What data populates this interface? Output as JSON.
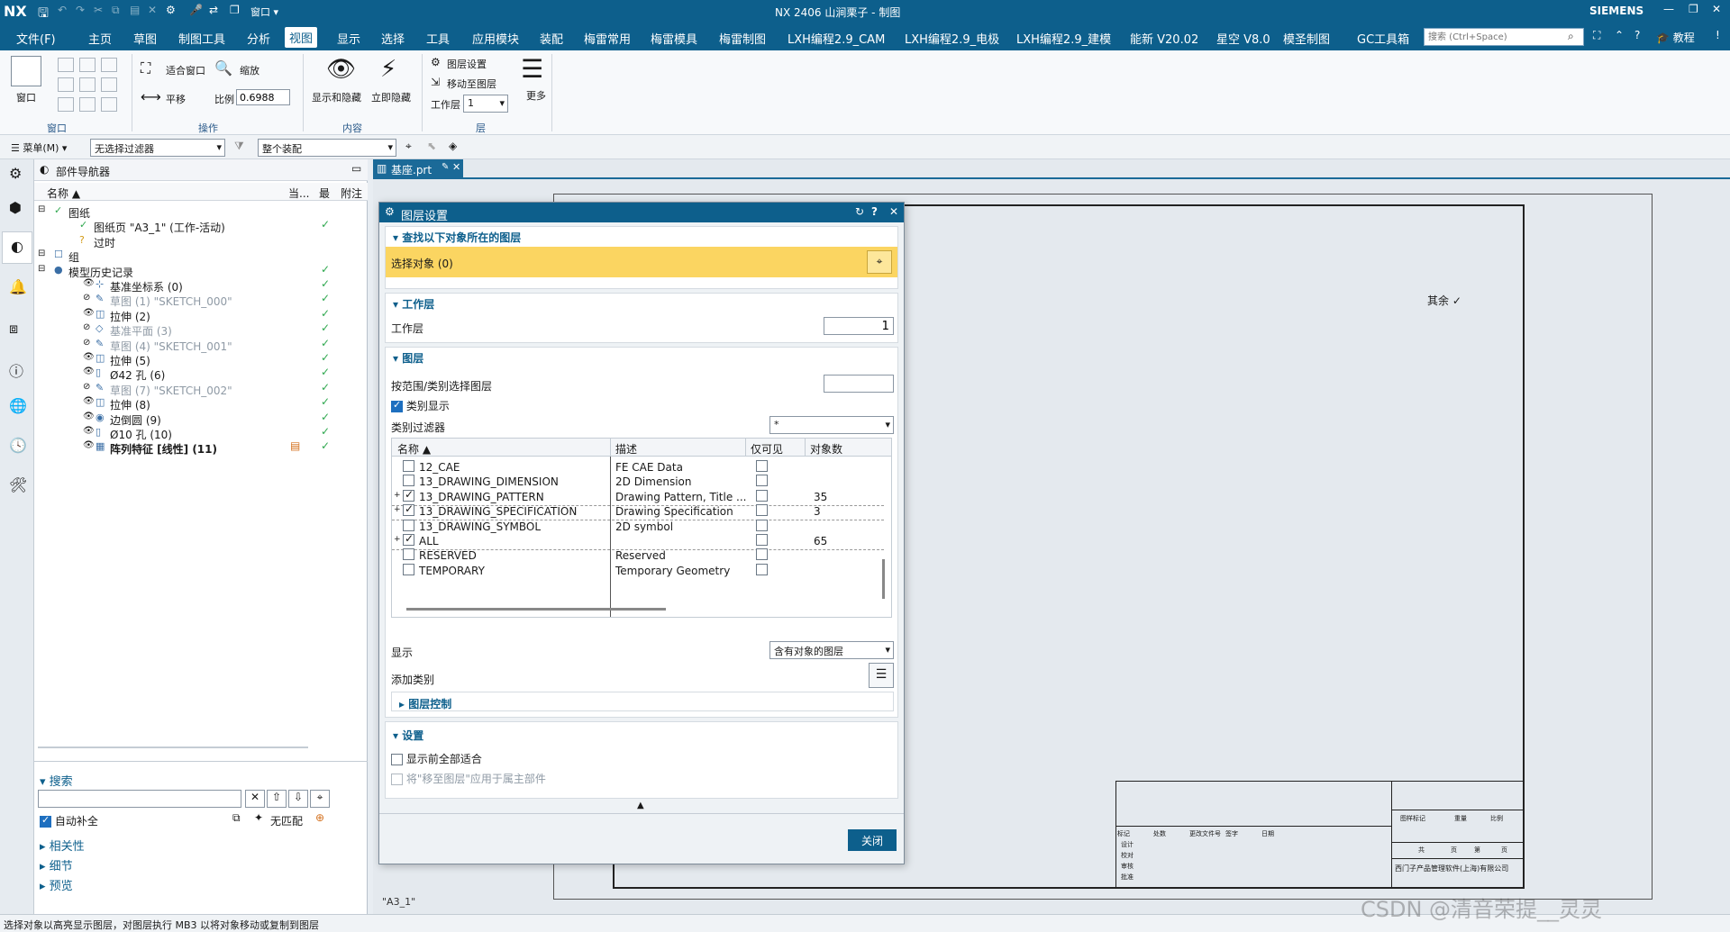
{
  "titlebar": {
    "logo": "NX",
    "title": "NX 2406 山涧栗子 - 制图",
    "brand": "SIEMENS",
    "window_menu": "窗口"
  },
  "menubar": {
    "items": [
      "文件(F)",
      "主页",
      "草图",
      "制图工具",
      "分析",
      "视图",
      "显示",
      "选择",
      "工具",
      "应用模块",
      "装配",
      "梅雷常用",
      "梅雷模具",
      "梅雷制图",
      "LXH编程2.9_CAM",
      "LXH编程2.9_电极",
      "LXH编程2.9_建模",
      "能新 V20.02",
      "星空 V8.0",
      "模圣制图",
      "GC工具箱"
    ],
    "active": "视图",
    "search_placeholder": "搜索 (Ctrl+Space)",
    "tutorial": "教程"
  },
  "ribbon": {
    "window_group": "窗口",
    "window_btn": "窗口",
    "ops_group": "操作",
    "fit_window": "适合窗口",
    "zoom": "缩放",
    "pan": "平移",
    "scale_label": "比例",
    "scale_value": "0.6988",
    "content_group": "内容",
    "show_hide": "显示和隐藏",
    "hide_now": "立即隐藏",
    "layer_group": "层",
    "layer_settings": "图层设置",
    "move_to_layer": "移动至图层",
    "work_layer_label": "工作层",
    "work_layer_value": "1",
    "more": "更多"
  },
  "cmdbar": {
    "menu": "菜单(M)",
    "filter": "无选择过滤器",
    "assembly": "整个装配"
  },
  "navigator": {
    "title": "部件导航器",
    "col_name": "名称",
    "col_current": "当...",
    "col_latest": "最",
    "col_note": "附注",
    "rows": [
      {
        "label": "图纸",
        "indent": 0,
        "grey": false,
        "bold": false
      },
      {
        "label": "图纸页 \"A3_1\" (工作-活动)",
        "indent": 2,
        "grey": false,
        "bold": false
      },
      {
        "label": "过时",
        "indent": 2,
        "grey": false,
        "bold": false
      },
      {
        "label": "组",
        "indent": 0,
        "grey": false,
        "bold": false
      },
      {
        "label": "模型历史记录",
        "indent": 0,
        "grey": false,
        "bold": false
      },
      {
        "label": "基准坐标系 (0)",
        "indent": 2,
        "grey": false,
        "bold": false
      },
      {
        "label": "草图 (1) \"SKETCH_000\"",
        "indent": 2,
        "grey": true,
        "bold": false
      },
      {
        "label": "拉伸 (2)",
        "indent": 2,
        "grey": false,
        "bold": false
      },
      {
        "label": "基准平面 (3)",
        "indent": 2,
        "grey": true,
        "bold": false
      },
      {
        "label": "草图 (4) \"SKETCH_001\"",
        "indent": 2,
        "grey": true,
        "bold": false
      },
      {
        "label": "拉伸 (5)",
        "indent": 2,
        "grey": false,
        "bold": false
      },
      {
        "label": "Ø42 孔 (6)",
        "indent": 2,
        "grey": false,
        "bold": false
      },
      {
        "label": "草图 (7) \"SKETCH_002\"",
        "indent": 2,
        "grey": true,
        "bold": false
      },
      {
        "label": "拉伸 (8)",
        "indent": 2,
        "grey": false,
        "bold": false
      },
      {
        "label": "边倒圆 (9)",
        "indent": 2,
        "grey": false,
        "bold": false
      },
      {
        "label": "Ø10 孔 (10)",
        "indent": 2,
        "grey": false,
        "bold": false
      },
      {
        "label": "阵列特征 [线性] (11)",
        "indent": 2,
        "grey": false,
        "bold": true
      }
    ],
    "search_label": "搜索",
    "auto_complete": "自动补全",
    "no_match": "无匹配",
    "relevance": "相关性",
    "details": "细节",
    "preview": "预览"
  },
  "tab": {
    "name": "基座.prt"
  },
  "dialog": {
    "title": "图层设置",
    "sec_find": "查找以下对象所在的图层",
    "select_object": "选择对象 (0)",
    "sec_work": "工作层",
    "work_layer_label": "工作层",
    "work_layer_value": "1",
    "sec_layers": "图层",
    "range_label": "按范围/类别选择图层",
    "category_display": "类别显示",
    "category_filter_label": "类别过滤器",
    "category_filter_value": "*",
    "col_name": "名称",
    "col_desc": "描述",
    "col_visible": "仅可见",
    "col_count": "对象数",
    "rows": [
      {
        "name": "12_CAE",
        "desc": "FE CAE Data",
        "checked": false,
        "count": "",
        "expand": false
      },
      {
        "name": "13_DRAWING_DIMENSION",
        "desc": "2D Dimension",
        "checked": false,
        "count": "",
        "expand": false
      },
      {
        "name": "13_DRAWING_PATTERN",
        "desc": "Drawing Pattern, Title ...",
        "checked": true,
        "count": "35",
        "expand": true
      },
      {
        "name": "13_DRAWING_SPECIFICATION",
        "desc": "Drawing Specification",
        "checked": true,
        "count": "3",
        "expand": true
      },
      {
        "name": "13_DRAWING_SYMBOL",
        "desc": "2D symbol",
        "checked": false,
        "count": "",
        "expand": false
      },
      {
        "name": "ALL",
        "desc": "",
        "checked": true,
        "count": "65",
        "expand": true
      },
      {
        "name": "RESERVED",
        "desc": "Reserved",
        "checked": false,
        "count": "",
        "expand": false
      },
      {
        "name": "TEMPORARY",
        "desc": "Temporary Geometry",
        "checked": false,
        "count": "",
        "expand": false
      }
    ],
    "display_label": "显示",
    "display_value": "含有对象的图层",
    "add_category": "添加类别",
    "layer_control": "图层控制",
    "sec_settings": "设置",
    "show_fit": "显示前全部适合",
    "apply_parent": "将\"移至图层\"应用于属主部件",
    "close": "关闭"
  },
  "drawing": {
    "sheet_label": "\"A3_1\"",
    "roughness": "其余",
    "company": "西门子产品管理软件(上海)有限公司",
    "title_cells": [
      "图样标记",
      "重量",
      "比例",
      "共",
      "页",
      "第",
      "页"
    ],
    "left_cells": [
      "标记",
      "处数",
      "更改文件号",
      "签字",
      "日期",
      "设计",
      "校对",
      "审核",
      "批准"
    ]
  },
  "status": {
    "text": "选择对象以高亮显示图层，对图层执行 MB3 以将对象移动或复制到图层",
    "watermark": "CSDN @清音荣提__灵灵"
  },
  "colors": {
    "brand": "#0d5f8c",
    "highlight": "#fbd561",
    "check": "#2fa84f"
  }
}
